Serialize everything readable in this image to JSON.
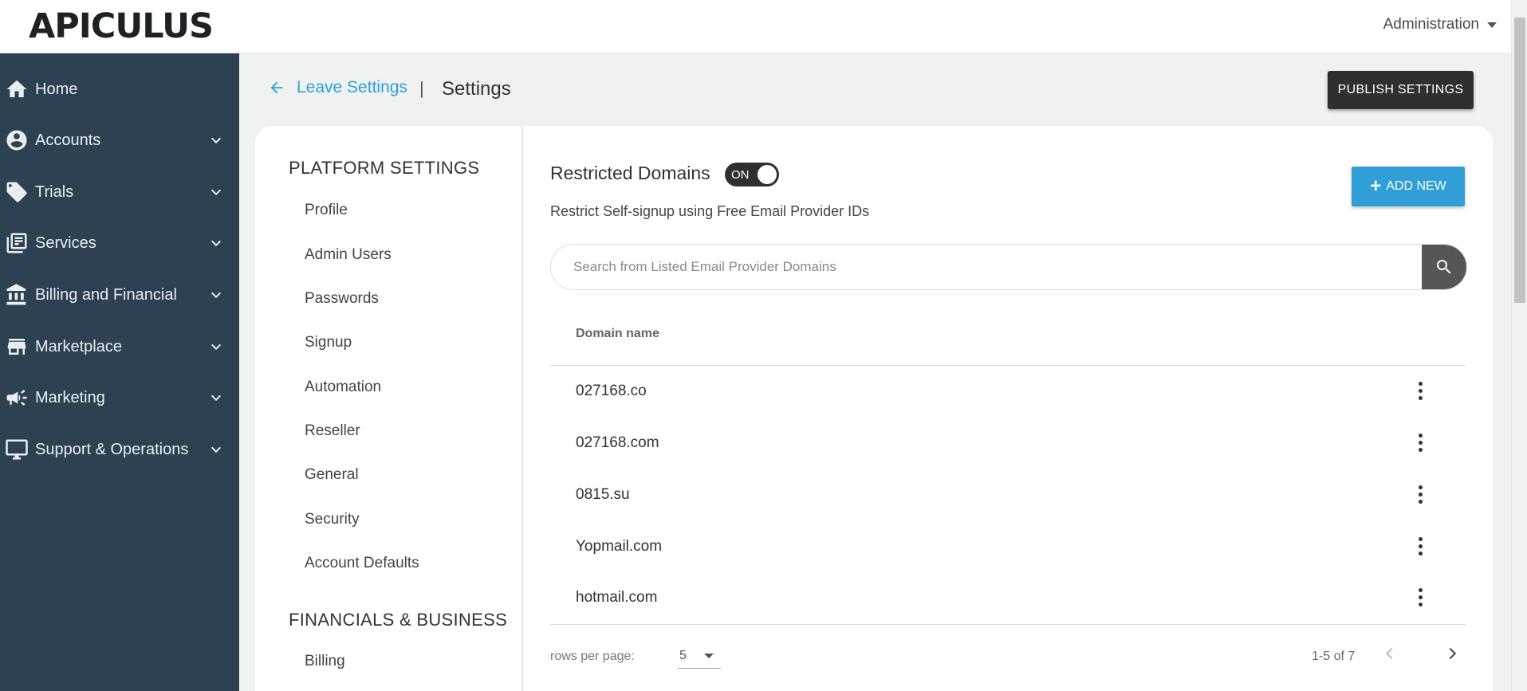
{
  "header": {
    "logo": "APICULUS",
    "admin_menu_label": "Administration"
  },
  "sidebar": {
    "items": [
      {
        "label": "Home",
        "icon": "home-icon",
        "expandable": false
      },
      {
        "label": "Accounts",
        "icon": "account-circle-icon",
        "expandable": true
      },
      {
        "label": "Trials",
        "icon": "tag-icon",
        "expandable": true
      },
      {
        "label": "Services",
        "icon": "library-icon",
        "expandable": true
      },
      {
        "label": "Billing and Financial",
        "icon": "bank-icon",
        "expandable": true
      },
      {
        "label": "Marketplace",
        "icon": "store-icon",
        "expandable": true
      },
      {
        "label": "Marketing",
        "icon": "megaphone-icon",
        "expandable": true
      },
      {
        "label": "Support & Operations",
        "icon": "monitor-icon",
        "expandable": true
      }
    ]
  },
  "page": {
    "back_label": "Leave Settings",
    "separator": "|",
    "title": "Settings",
    "publish_label": "PUBLISH SETTINGS"
  },
  "settings_menu": {
    "groups": [
      {
        "title": "PLATFORM SETTINGS",
        "items": [
          "Profile",
          "Admin Users",
          "Passwords",
          "Signup",
          "Automation",
          "Reseller",
          "General",
          "Security",
          "Account Defaults"
        ]
      },
      {
        "title": "FINANCIALS & BUSINESS",
        "items": [
          "Billing"
        ]
      }
    ]
  },
  "restricted": {
    "title": "Restricted Domains",
    "toggle_label": "ON",
    "toggle_on": true,
    "description": "Restrict Self-signup using Free Email Provider IDs",
    "add_label": "ADD NEW",
    "search_placeholder": "Search from Listed Email Provider Domains",
    "search_value": ""
  },
  "table": {
    "column": "Domain name",
    "rows": [
      "027168.co",
      "027168.com",
      "0815.su",
      "Yopmail.com",
      "hotmail.com"
    ]
  },
  "pagination": {
    "rows_per_page_label": "rows per page:",
    "rows_per_page": "5",
    "range": "1-5 of 7"
  },
  "colors": {
    "sidebar_bg": "#2e4152",
    "accent": "#2f9fd6",
    "dark_button": "#2f2f31"
  }
}
